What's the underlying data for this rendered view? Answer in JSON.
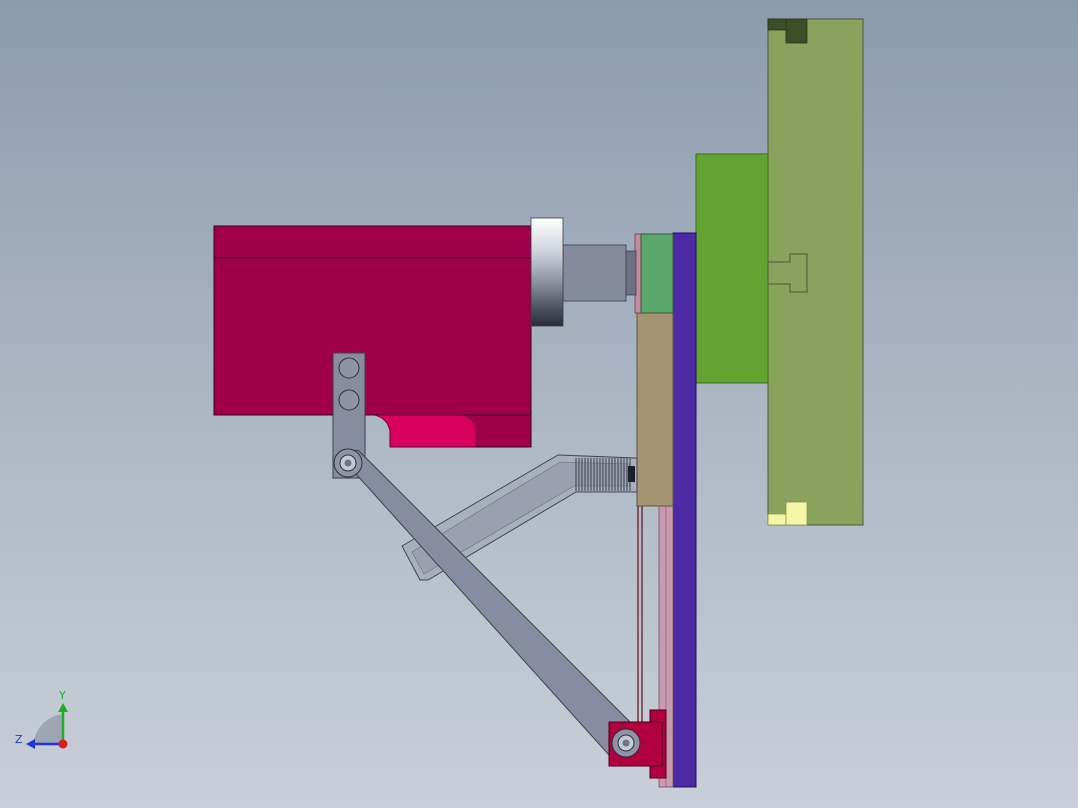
{
  "triad": {
    "y_label": "Y",
    "z_label": "Z",
    "y_color": "#1fae2a",
    "z_color": "#2035d8",
    "x_color": "#d81f1f"
  },
  "colors": {
    "motor_body": "#a0004a",
    "motor_body_dark": "#82003a",
    "motor_slot": "#d8005e",
    "steel_ring": "#d6dbe3",
    "shaft": "#868a9d",
    "link_arm": "#878ca1",
    "link_edge": "#3c4050",
    "green_block": "#5ba66a",
    "tan_block": "#a49474",
    "blue_plate": "#4b2aa4",
    "pink_strip": "#c99aaf",
    "pivot_block": "#b0003e",
    "lime_block": "#63a331",
    "olive_plate": "#89a35f",
    "olive_dark_tab": "#3d4f26",
    "yellow_tab": "#f3f7a5"
  }
}
